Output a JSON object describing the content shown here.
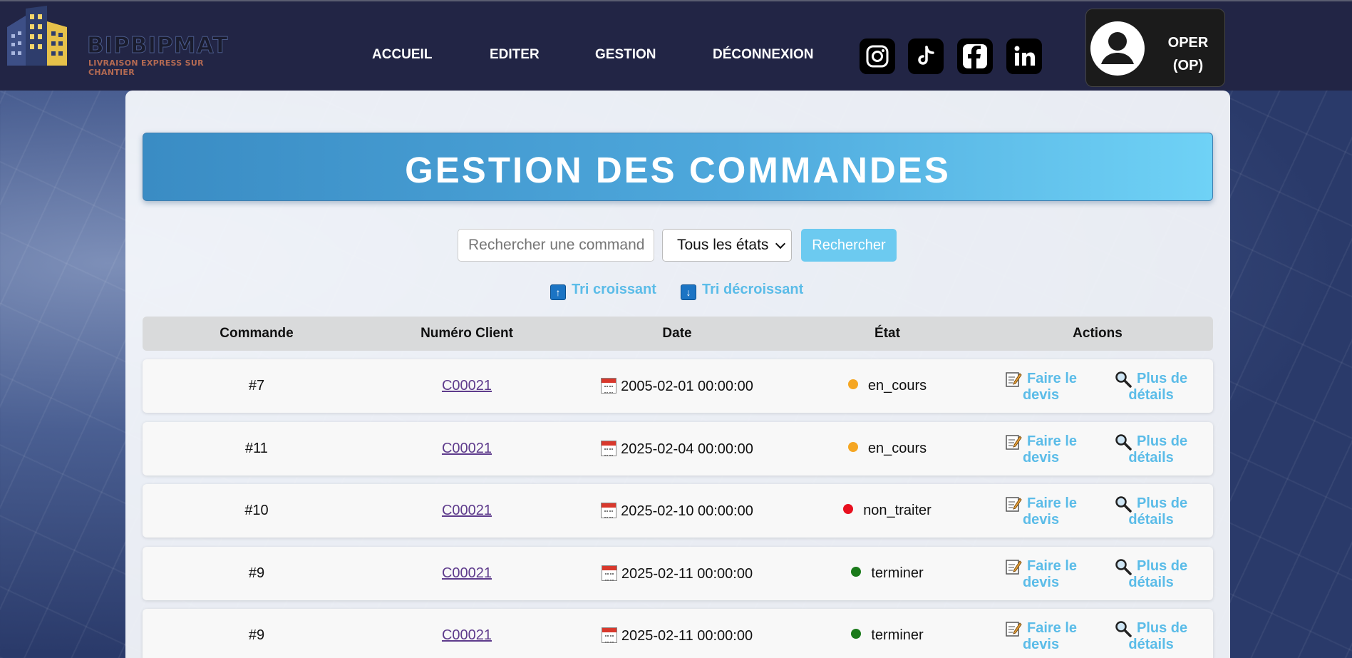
{
  "brand": {
    "name": "BIPBIPMAT",
    "tagline": "LIVRAISON EXPRESS SUR CHANTIER"
  },
  "nav": {
    "items": [
      "ACCUEIL",
      "EDITER",
      "GESTION",
      "DÉCONNEXION"
    ]
  },
  "social": [
    "instagram-icon",
    "tiktok-icon",
    "facebook-icon",
    "linkedin-icon"
  ],
  "user": {
    "name": "OPER",
    "role": "(OP)"
  },
  "page": {
    "title": "GESTION DES COMMANDES"
  },
  "search": {
    "placeholder": "Rechercher une commande",
    "state_selected": "Tous les états",
    "button_label": "Rechercher"
  },
  "sort": {
    "asc_label": "Tri croissant",
    "desc_label": "Tri décroissant"
  },
  "table": {
    "headers": [
      "Commande",
      "Numéro Client",
      "Date",
      "État",
      "Actions"
    ],
    "rows": [
      {
        "order": "#7",
        "client": "C00021",
        "date": "2005-02-01 00:00:00",
        "state": "en_cours",
        "state_color": "#f5a623"
      },
      {
        "order": "#11",
        "client": "C00021",
        "date": "2025-02-04 00:00:00",
        "state": "en_cours",
        "state_color": "#f5a623"
      },
      {
        "order": "#10",
        "client": "C00021",
        "date": "2025-02-10 00:00:00",
        "state": "non_traiter",
        "state_color": "#e8101f"
      },
      {
        "order": "#9",
        "client": "C00021",
        "date": "2025-02-11 00:00:00",
        "state": "terminer",
        "state_color": "#1a7a1a"
      },
      {
        "order": "#9",
        "client": "C00021",
        "date": "2025-02-11 00:00:00",
        "state": "terminer",
        "state_color": "#1a7a1a"
      }
    ],
    "action_quote": {
      "line1": "Faire le",
      "line2": "devis",
      "icon": "memo-icon"
    },
    "action_details": {
      "line1": "Plus de",
      "line2": "détails",
      "icon": "magnifier-icon"
    }
  },
  "colors": {
    "header_bg": "#222545",
    "accent": "#5bbce8",
    "banner_start": "#3a8cc4",
    "banner_end": "#6fd2f6"
  }
}
